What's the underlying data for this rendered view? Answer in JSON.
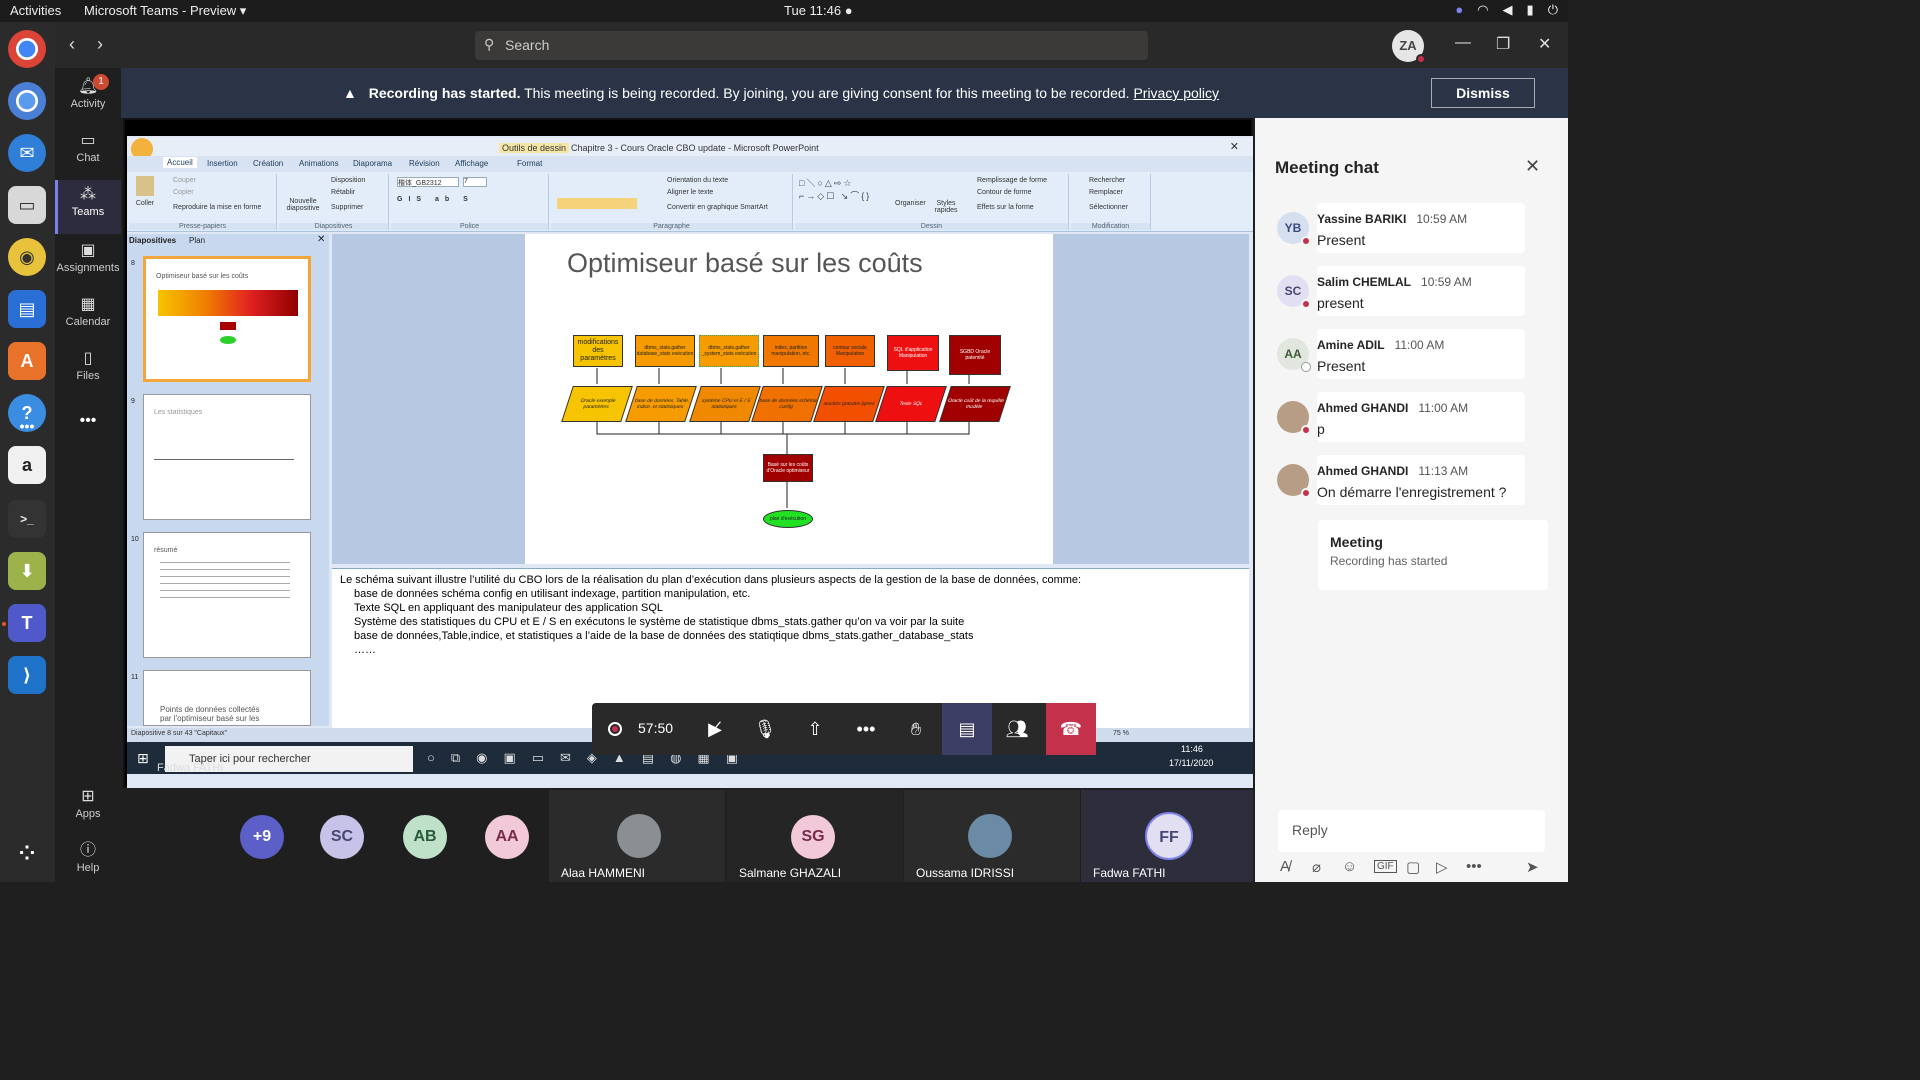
{
  "system_bar": {
    "activities": "Activities",
    "app_name": "Microsoft Teams - Preview ▾",
    "clock": "Tue 11:46 ●"
  },
  "rail": {
    "items": [
      {
        "label": "Activity",
        "icon": "bell-icon",
        "badge": "1"
      },
      {
        "label": "Chat",
        "icon": "chat-icon"
      },
      {
        "label": "Teams",
        "icon": "teams-icon"
      },
      {
        "label": "Assignments",
        "icon": "assignments-icon"
      },
      {
        "label": "Calendar",
        "icon": "calendar-icon"
      },
      {
        "label": "Files",
        "icon": "files-icon"
      }
    ],
    "more": "•••",
    "apps": "Apps",
    "help": "Help"
  },
  "header": {
    "search_placeholder": "Search",
    "user_initials": "ZA"
  },
  "banner": {
    "title": "Recording has started.",
    "message": "This meeting is being recorded. By joining, you are giving consent for this meeting to be recorded.",
    "link": "Privacy policy",
    "dismiss": "Dismiss"
  },
  "powerpoint": {
    "window_title": "Chapitre 3 - Cours Oracle CBO update - Microsoft PowerPoint",
    "contextual_tab": "Outils de dessin",
    "tabs": [
      "Accueil",
      "Insertion",
      "Création",
      "Animations",
      "Diaporama",
      "Révision",
      "Affichage",
      "Format"
    ],
    "groups": [
      "Presse-papiers",
      "Diapositives",
      "Police",
      "Paragraphe",
      "Dessin",
      "Modification"
    ],
    "clipboard": {
      "paste": "Coller",
      "cut": "Couper",
      "copy": "Copier",
      "format_painter": "Reproduire la mise en forme"
    },
    "slides_group": {
      "new": "Nouvelle diapositive",
      "layout": "Disposition",
      "reset": "Rétablir",
      "delete": "Supprimer"
    },
    "paragraph": {
      "direction": "Orientation du texte",
      "align": "Aligner le texte",
      "smartart": "Convertir en graphique SmartArt"
    },
    "drawing": {
      "arrange": "Organiser",
      "styles": "Styles rapides",
      "fill": "Remplissage de forme",
      "outline": "Contour de forme",
      "effects": "Effets sur la forme"
    },
    "editing": {
      "find": "Rechercher",
      "replace": "Remplacer",
      "select": "Sélectionner"
    },
    "font_name": "楷体_GB2312",
    "font_size": "7",
    "panel_tabs": [
      "Diapositives",
      "Plan"
    ],
    "thumbs": [
      {
        "num": "8",
        "title": "Optimiseur basé sur les coûts"
      },
      {
        "num": "9",
        "title": "Les statistiques"
      },
      {
        "num": "10",
        "title": "résumé"
      },
      {
        "num": "11",
        "title": "Points de données collectés par l'optimiseur basé sur les"
      }
    ],
    "slide_title": "Optimiseur basé sur les coûts",
    "flow_top": [
      "modifications des paramètres",
      "dbms_stats.gather database_stats exécution",
      "dbms_stats.gather _system_stats exécution",
      "index, partition manipulation, etc.",
      "contour sociale Manipulation",
      "SQL d'application Manipulation",
      "SGBD Oracle patemité"
    ],
    "flow_bottom": [
      "Oracle exemple paramètres",
      "base de données, Table, indice, et statistiques",
      "système CPU et E / S statistiques",
      "base de données schéma config",
      "stockés grandes lignes",
      "Texte SQL",
      "Oracle coût de la requête modèle"
    ],
    "flow_mid": "Basé sur les coûts d'Oracle optimiseur",
    "flow_end": "plan d'exécution",
    "notes": [
      "Le schéma suivant illustre l’utilité du CBO lors de la réalisation du plan d’exécution dans plusieurs aspects de la gestion de la base de données, comme:",
      "base de données schéma  config en utilisant indexage, partition  manipulation, etc.",
      "Texte SQL  en appliquant  des manipulateur  des application  SQL",
      "Système des statistiques du CPU et E / S    en exécutons le système de statistique dbms_stats.gather qu’on va voir par la suite",
      "base de données,Table,indice, et statistiques  a l’aide de la base de données des statiqtique dbms_stats.gather_database_stats",
      "……"
    ],
    "status": "Diapositive 8 sur 43    \"Capitaux\"",
    "zoom": "75 %",
    "taskbar_search": "Taper ici pour rechercher",
    "taskbar_time": "11:46",
    "taskbar_date": "17/11/2020",
    "presenter_label": "Fadwa FATHI"
  },
  "controls": {
    "timer": "57:50"
  },
  "participants": {
    "overflow": "+9",
    "avatars": [
      {
        "initials": "SC",
        "color": "#c7c3e8"
      },
      {
        "initials": "AB",
        "color": "#bfe0c9"
      },
      {
        "initials": "AA",
        "color": "#f1c9d8"
      }
    ],
    "tiles": [
      {
        "name": "Alaa HAMMENI",
        "kind": "photo"
      },
      {
        "name": "Salmane GHAZALI",
        "initials": "SG",
        "kind": "initials"
      },
      {
        "name": "Oussama IDRISSI",
        "kind": "photo"
      },
      {
        "name": "Fadwa FATHI",
        "initials": "FF",
        "kind": "initials"
      }
    ]
  },
  "chat": {
    "title": "Meeting chat",
    "messages": [
      {
        "initials": "YB",
        "name": "Yassine BARIKI",
        "time": "10:59 AM",
        "text": "Present",
        "avatar_color": "#d6dff0",
        "status": "busy"
      },
      {
        "initials": "SC",
        "name": "Salim CHEMLAL",
        "time": "10:59 AM",
        "text": "present",
        "avatar_color": "#e3dff2",
        "status": "busy"
      },
      {
        "initials": "AA",
        "name": "Amine ADIL",
        "time": "11:00 AM",
        "text": "Present",
        "avatar_color": "#e1e6df",
        "status": "away"
      },
      {
        "initials": "",
        "name": "Ahmed GHANDI",
        "time": "11:00 AM",
        "text": "p",
        "avatar_color": "#b79d86",
        "status": "busy"
      },
      {
        "initials": "",
        "name": "Ahmed GHANDI",
        "time": "11:13 AM",
        "text": "On démarre l'enregistrement ?",
        "avatar_color": "#b79d86",
        "status": "busy"
      }
    ],
    "system": {
      "title": "Meeting",
      "subtitle": "Recording has started"
    },
    "reply_placeholder": "Reply"
  }
}
